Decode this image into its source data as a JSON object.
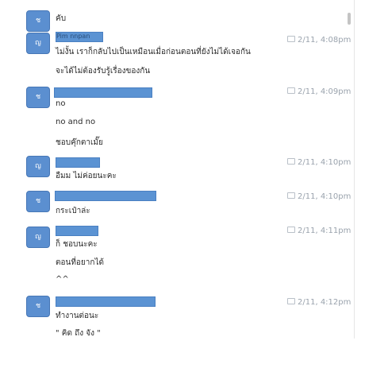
{
  "chat": {
    "messages": [
      {
        "avatar": "ช",
        "name": "",
        "time": "",
        "lines": [
          "คับ"
        ]
      },
      {
        "avatar": "ญ",
        "name": "Pim nnpan",
        "time": "2/11, 4:08pm",
        "lines": [
          "ไม่งั้น เราก็กลับไปเป็นเหมือนเมื่อก่อนตอนที่ยังไม่ได้เจอกัน",
          "จะได้ไม่ต้องรับรู้เรื่องของกัน"
        ]
      },
      {
        "avatar": "ช",
        "name": "",
        "time": "2/11, 4:09pm",
        "lines": [
          "no",
          "no and no",
          "ชอบคุ๊กตาเมั๊ย"
        ]
      },
      {
        "avatar": "ญ",
        "name": "",
        "time": "2/11, 4:10pm",
        "lines": [
          "อืมม ไม่ค่อยนะคะ"
        ]
      },
      {
        "avatar": "ช",
        "name": "",
        "time": "2/11, 4:10pm",
        "lines": [
          "กระเป๋าล่ะ"
        ]
      },
      {
        "avatar": "ญ",
        "name": "",
        "time": "2/11, 4:11pm",
        "lines": [
          "ก็ ชอบนะคะ",
          "ตอนที่อยากได้",
          "^^"
        ]
      },
      {
        "avatar": "ช",
        "name": "",
        "time": "2/11, 4:12pm",
        "lines": [
          "ทำงานต่อนะ",
          "\" คิด ถึง จัง \""
        ]
      }
    ]
  }
}
